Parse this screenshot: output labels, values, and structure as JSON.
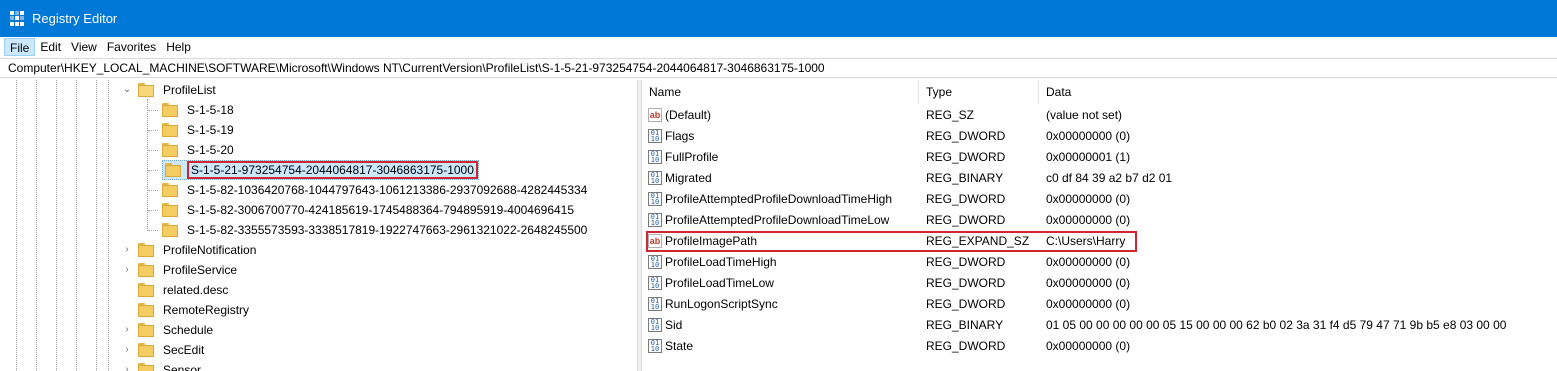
{
  "window": {
    "title": "Registry Editor"
  },
  "menu": {
    "items": [
      {
        "label": "File",
        "active": true
      },
      {
        "label": "Edit"
      },
      {
        "label": "View"
      },
      {
        "label": "Favorites"
      },
      {
        "label": "Help"
      }
    ]
  },
  "address": {
    "path": "Computer\\HKEY_LOCAL_MACHINE\\SOFTWARE\\Microsoft\\Windows NT\\CurrentVersion\\ProfileList\\S-1-5-21-973254754-2044064817-3046863175-1000"
  },
  "tree": {
    "parent": {
      "label": "ProfileList",
      "expander": "⌄"
    },
    "children": [
      {
        "label": "S-1-5-18"
      },
      {
        "label": "S-1-5-19"
      },
      {
        "label": "S-1-5-20"
      },
      {
        "label": "S-1-5-21-973254754-2044064817-3046863175-1000",
        "selected": true
      },
      {
        "label": "S-1-5-82-1036420768-1044797643-1061213386-2937092688-4282445334"
      },
      {
        "label": "S-1-5-82-3006700770-424185619-1745488364-794895919-4004696415"
      },
      {
        "label": "S-1-5-82-3355573593-3338517819-1922747663-2961321022-2648245500"
      }
    ],
    "siblings": [
      {
        "label": "ProfileNotification",
        "expander": "›"
      },
      {
        "label": "ProfileService",
        "expander": "›"
      },
      {
        "label": "related.desc",
        "expander": ""
      },
      {
        "label": "RemoteRegistry",
        "expander": ""
      },
      {
        "label": "Schedule",
        "expander": "›"
      },
      {
        "label": "SecEdit",
        "expander": "›"
      },
      {
        "label": "Sensor",
        "expander": "›"
      }
    ]
  },
  "list": {
    "columns": {
      "name": "Name",
      "type": "Type",
      "data": "Data"
    },
    "rows": [
      {
        "icon": "string-value-icon",
        "glyph": "ab",
        "name": "(Default)",
        "type": "REG_SZ",
        "data": "(value not set)"
      },
      {
        "icon": "binary-value-icon",
        "glyph": "01\n10",
        "name": "Flags",
        "type": "REG_DWORD",
        "data": "0x00000000 (0)"
      },
      {
        "icon": "binary-value-icon",
        "glyph": "01\n10",
        "name": "FullProfile",
        "type": "REG_DWORD",
        "data": "0x00000001 (1)"
      },
      {
        "icon": "binary-value-icon",
        "glyph": "01\n10",
        "name": "Migrated",
        "type": "REG_BINARY",
        "data": "c0 df 84 39 a2 b7 d2 01"
      },
      {
        "icon": "binary-value-icon",
        "glyph": "01\n10",
        "name": "ProfileAttemptedProfileDownloadTimeHigh",
        "type": "REG_DWORD",
        "data": "0x00000000 (0)"
      },
      {
        "icon": "binary-value-icon",
        "glyph": "01\n10",
        "name": "ProfileAttemptedProfileDownloadTimeLow",
        "type": "REG_DWORD",
        "data": "0x00000000 (0)"
      },
      {
        "icon": "string-value-icon",
        "glyph": "ab",
        "name": "ProfileImagePath",
        "type": "REG_EXPAND_SZ",
        "data": "C:\\Users\\Harry",
        "highlighted": true
      },
      {
        "icon": "binary-value-icon",
        "glyph": "01\n10",
        "name": "ProfileLoadTimeHigh",
        "type": "REG_DWORD",
        "data": "0x00000000 (0)"
      },
      {
        "icon": "binary-value-icon",
        "glyph": "01\n10",
        "name": "ProfileLoadTimeLow",
        "type": "REG_DWORD",
        "data": "0x00000000 (0)"
      },
      {
        "icon": "binary-value-icon",
        "glyph": "01\n10",
        "name": "RunLogonScriptSync",
        "type": "REG_DWORD",
        "data": "0x00000000 (0)"
      },
      {
        "icon": "binary-value-icon",
        "glyph": "01\n10",
        "name": "Sid",
        "type": "REG_BINARY",
        "data": "01 05 00 00 00 00 00 05 15 00 00 00 62 b0 02 3a 31 f4 d5 79 47 71 9b b5 e8 03 00 00"
      },
      {
        "icon": "binary-value-icon",
        "glyph": "01\n10",
        "name": "State",
        "type": "REG_DWORD",
        "data": "0x00000000 (0)"
      }
    ]
  },
  "colors": {
    "titlebar": "#0078d7",
    "selection": "#cce8ff",
    "highlight_border": "#d0272f"
  }
}
